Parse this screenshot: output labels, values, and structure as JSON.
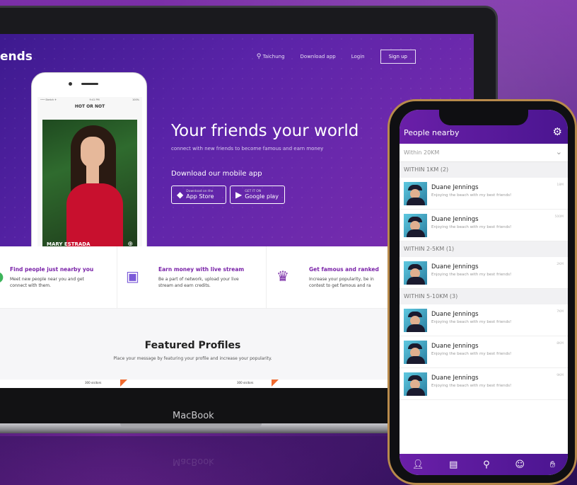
{
  "laptop": {
    "logo": "ends",
    "nav": {
      "location": "Taichung",
      "download": "Download app",
      "login": "Login",
      "signup": "Sign up"
    },
    "hero": {
      "title": "Your friends your world",
      "subtitle": "connect with new friends to become famous and earn money",
      "download_label": "Download our mobile app",
      "appstore_small": "Download on the",
      "appstore_large": "App Store",
      "gplay_small": "GET IT ON",
      "gplay_large": "Google play"
    },
    "mini_phone": {
      "status_left": "••• Sketch ✈",
      "status_mid": "9:41 PM",
      "status_right": "100%",
      "title": "HOT OR NOT",
      "name": "MARY ESTRADA"
    },
    "features": [
      {
        "title": "Find people just nearby you",
        "desc": "Meet new people near you and get connect with them."
      },
      {
        "title": "Earn money with live stream",
        "desc": "Be a part of network, upload your live stream and earn credits."
      },
      {
        "title": "Get famous and ranked",
        "desc": "Increase your popularity, be in contest to get famous and ra"
      }
    ],
    "featured": {
      "title": "Featured Profiles",
      "subtitle": "Place your message by featuring your profile and increase your popularity.",
      "visitors_1": "300 visitors",
      "visitors_2": "300 visitors"
    },
    "brand": "MacBook"
  },
  "phone": {
    "title": "People nearby",
    "filter": "Within 20KM",
    "sections": [
      {
        "header": "WITHIN 1KM (2)",
        "rows": [
          {
            "name": "Duane Jennings",
            "status": "Enjoying the beach with my best friends!",
            "dist": "18M"
          },
          {
            "name": "Duane Jennings",
            "status": "Enjoying the beach with my best friends!",
            "dist": "500M"
          }
        ]
      },
      {
        "header": "WITHIN 2-5KM (1)",
        "rows": [
          {
            "name": "Duane Jennings",
            "status": "Enjoying the beach with my best friends!",
            "dist": "2KM"
          }
        ]
      },
      {
        "header": "WITHIN 5-10KM (3)",
        "rows": [
          {
            "name": "Duane Jennings",
            "status": "Enjoying the beach with my best friends!",
            "dist": "7KM"
          },
          {
            "name": "Duane Jennings",
            "status": "Enjoying the beach with my best friends!",
            "dist": "8KM"
          },
          {
            "name": "Duane Jennings",
            "status": "Enjoying the beach with my best friends!",
            "dist": "9KM"
          }
        ]
      }
    ],
    "tabs": [
      "person-icon",
      "chat-icon",
      "location-pin-icon",
      "smiley-icon",
      "hand-coin-icon"
    ]
  }
}
